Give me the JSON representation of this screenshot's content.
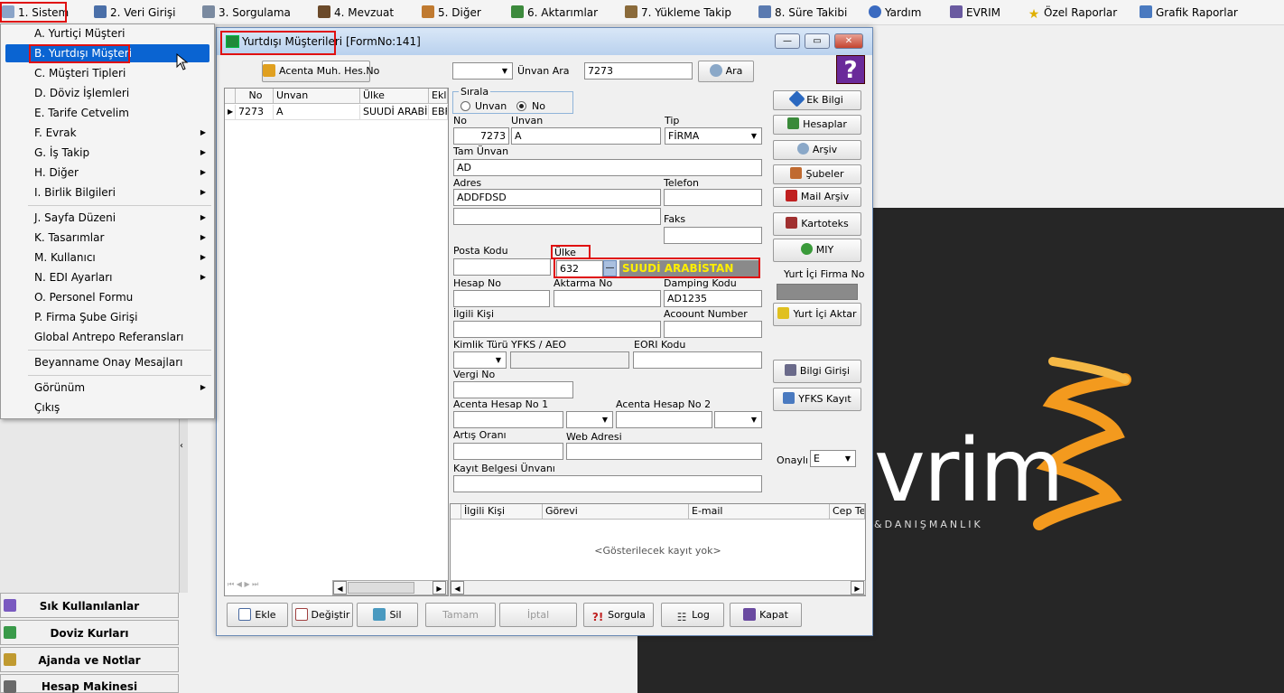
{
  "menubar": {
    "items": [
      {
        "label": "1.  Sistem",
        "icon": "gear-icon"
      },
      {
        "label": "2.  Veri Girişi",
        "icon": "pen-icon"
      },
      {
        "label": "3.  Sorgulama",
        "icon": "search-icon"
      },
      {
        "label": "4.  Mevzuat",
        "icon": "books-icon"
      },
      {
        "label": "5.  Diğer",
        "icon": "tools-icon"
      },
      {
        "label": "6.  Aktarımlar",
        "icon": "transfer-icon"
      },
      {
        "label": "7.  Yükleme Takip",
        "icon": "truck-icon"
      },
      {
        "label": "8. Süre Takibi",
        "icon": "calendar-icon"
      },
      {
        "label": "Yardım",
        "icon": "help-icon"
      },
      {
        "label": "EVRIM",
        "icon": "evrim-icon"
      },
      {
        "label": "Özel Raporlar",
        "icon": "star-icon"
      },
      {
        "label": "Grafik Raporlar",
        "icon": "chart-icon"
      }
    ]
  },
  "sistem_menu": {
    "items": [
      "A.  Yurtiçi Müşteri",
      "B.  Yurtdışı Müşteri",
      "C.  Müşteri Tipleri",
      "D.  Döviz İşlemleri",
      "E.  Tarife Cetvelim",
      "F.  Evrak",
      "G.  İş Takip",
      "H.  Diğer",
      "I.  Birlik Bilgileri",
      "J.  Sayfa Düzeni",
      "K.  Tasarımlar",
      "M.  Kullanıcı",
      "N.  EDI Ayarları",
      "O.  Personel Formu",
      "P.  Firma Şube Girişi",
      "Global Antrepo Referansları",
      "Beyanname Onay Mesajları",
      "Görünüm",
      "Çıkış"
    ]
  },
  "left_panel": {
    "buttons": [
      "Sık Kullanılanlar",
      "Doviz Kurları",
      "Ajanda ve Notlar",
      "Hesap Makinesi"
    ]
  },
  "brand": {
    "logo_word": "vrim",
    "logo_sub": "&DANIŞMANLIK"
  },
  "window": {
    "title": "Yurtdışı Müşterileri",
    "form_no": "[FormNo:141]",
    "toolbar": {
      "acenta_button": "Acenta Muh. Hes.No",
      "search_field_label": "Ünvan Ara",
      "search_value": "7273",
      "search_button": "Ara",
      "help_glyph": "?"
    },
    "list": {
      "headers": [
        "No",
        "Unvan",
        "Ülke",
        "Ekle"
      ],
      "rows": [
        [
          "7273",
          "A",
          "SUUDİ ARABİ:",
          "EBF"
        ]
      ]
    },
    "sort": {
      "legend": "Sırala",
      "option_unvan": "Unvan",
      "option_no": "No"
    },
    "form": {
      "no_label": "No",
      "no_value": "7273",
      "unvan_label": "Unvan",
      "unvan_value": "A",
      "tip_label": "Tip",
      "tip_value": "FİRMA",
      "tam_unvan_label": "Tam Ünvan",
      "tam_unvan_value": "AD",
      "adres_label": "Adres",
      "adres_value": "ADDFDSD",
      "telefon_label": "Telefon",
      "faks_label": "Faks",
      "posta_kodu_label": "Posta Kodu",
      "ulke_label": "Ülke",
      "ulke_code": "632",
      "ulke_name": "SUUDİ ARABİSTAN",
      "hesap_no_label": "Hesap No",
      "aktarma_no_label": "Aktarma No",
      "damping_kodu_label": "Damping Kodu",
      "damping_kodu_value": "AD1235",
      "ilgili_kisi_label": "İlgili Kişi",
      "account_number_label": "Acoount Number",
      "kimlik_turu_label": "Kimlik Türü",
      "yfks_label": "YFKS / AEO",
      "eori_label": "EORI Kodu",
      "vergi_no_label": "Vergi No",
      "acenta1_label": "Acenta Hesap No 1",
      "acenta2_label": "Acenta Hesap No 2",
      "artis_label": "Artış Oranı",
      "web_label": "Web Adresi",
      "kayit_belgesi_label": "Kayıt Belgesi Ünvanı"
    },
    "side_buttons": {
      "ek_bilgi": "Ek Bilgi",
      "hesaplar": "Hesaplar",
      "arsiv": "Arşiv",
      "subeler": "Şubeler",
      "mail_arsiv": "Mail Arşiv",
      "kartoteks": "Kartoteks",
      "miy": "MIY",
      "yurt_ici_firma_no": "Yurt İçi Firma No",
      "yurt_ici_aktar": "Yurt İçi Aktar",
      "bilgi_girisi": "Bilgi Girişi",
      "yfks_kayit": "YFKS Kayıt",
      "onayli_label": "Onaylı",
      "onayli_value": "E"
    },
    "contacts": {
      "headers": [
        "İlgili Kişi",
        "Görevi",
        "E-mail",
        "Cep Tel"
      ],
      "empty": "<Gösterilecek kayıt yok>"
    },
    "bottom_buttons": {
      "ekle": "Ekle",
      "degistir": "Değiştir",
      "sil": "Sil",
      "tamam": "Tamam",
      "iptal": "İptal",
      "sorgula": "Sorgula",
      "log": "Log",
      "kapat": "Kapat"
    }
  },
  "colors": {
    "highlight_red": "#e01010",
    "selection_blue": "#0a64d2",
    "country_text": "#ffef00",
    "logo_orange": "#f39a1e"
  }
}
